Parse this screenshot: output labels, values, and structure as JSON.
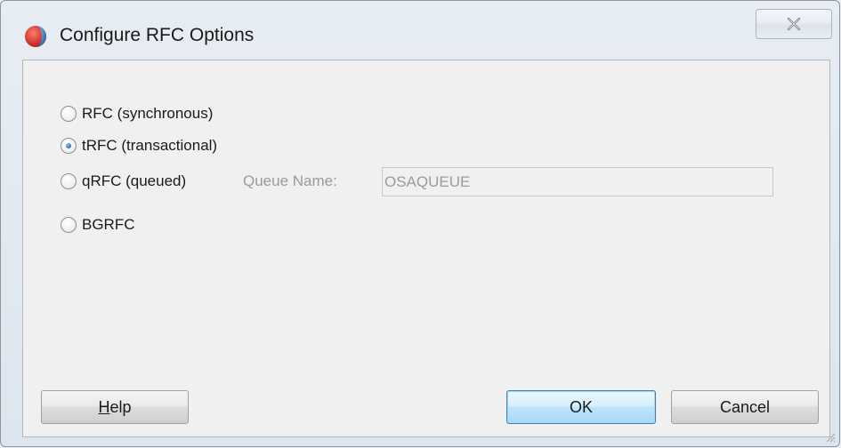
{
  "dialog": {
    "title": "Configure RFC Options",
    "close_icon": "close-icon",
    "app_icon": "oracle-logo-icon"
  },
  "options": [
    {
      "label": "RFC (synchronous)",
      "selected": false
    },
    {
      "label": "tRFC (transactional)",
      "selected": true
    },
    {
      "label": "qRFC (queued)",
      "selected": false
    },
    {
      "label": "BGRFC",
      "selected": false
    }
  ],
  "queue": {
    "label": "Queue Name:",
    "value": "OSAQUEUE",
    "enabled": false
  },
  "buttons": {
    "help_prefix": "",
    "help_mnemonic": "H",
    "help_rest": "elp",
    "ok": "OK",
    "cancel": "Cancel"
  },
  "colors": {
    "accent": "#3c7fb1",
    "brand_red": "#d7261e",
    "disabled_text": "#9b9b9b"
  }
}
